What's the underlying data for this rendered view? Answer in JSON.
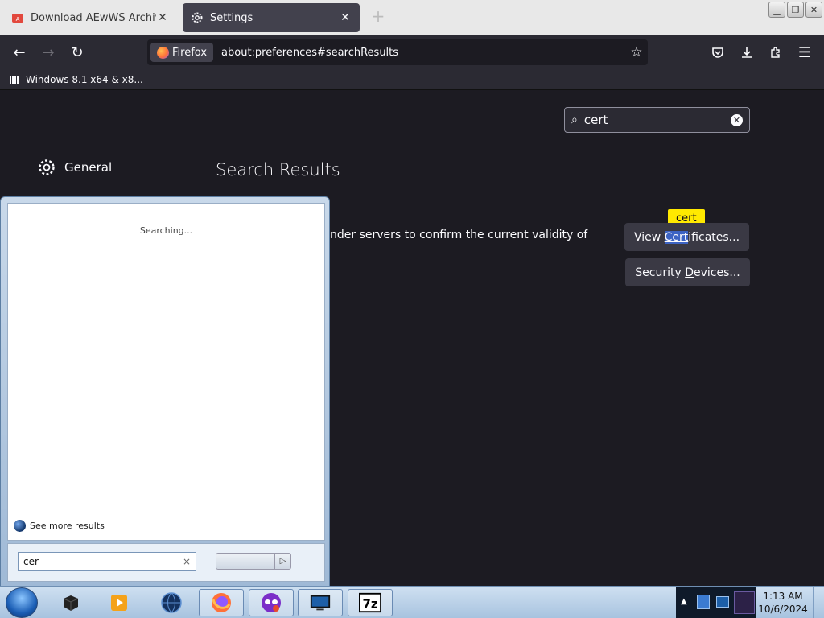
{
  "browser": {
    "tabs": [
      {
        "title": "Download AEwWS Archive by A",
        "close": "✕"
      },
      {
        "title": "Settings",
        "close": "✕"
      }
    ],
    "new_tab": "+",
    "identity_label": "Firefox",
    "url": "about:preferences#searchResults",
    "bookmark": "Windows 8.1 x64 & x8..."
  },
  "prefs": {
    "search_value": "cert",
    "category_general": "General",
    "heading": "Search Results",
    "body_text": "nder servers to confirm the current validity of",
    "tooltip": "cert",
    "view_certs": {
      "before": "View ",
      "highlight": "Cert",
      "after": "ificates..."
    },
    "security_devices": {
      "before": "Security ",
      "underline": "D",
      "after": "evices..."
    }
  },
  "start_menu": {
    "status": "Searching...",
    "see_more": "See more results",
    "search_value": "cer",
    "clear": "×"
  },
  "taskbar": {
    "time": "1:13 AM",
    "date": "10/6/2024",
    "apps": [
      "explorer-cube-icon",
      "media-player-icon",
      "globe-icon",
      "firefox-icon",
      "tor-mask-icon",
      "monitor-icon",
      "7zip-icon"
    ]
  },
  "colors": {
    "accent": "#3c63c3",
    "tooltip": "#ffe900",
    "page_bg": "#1c1b22"
  }
}
